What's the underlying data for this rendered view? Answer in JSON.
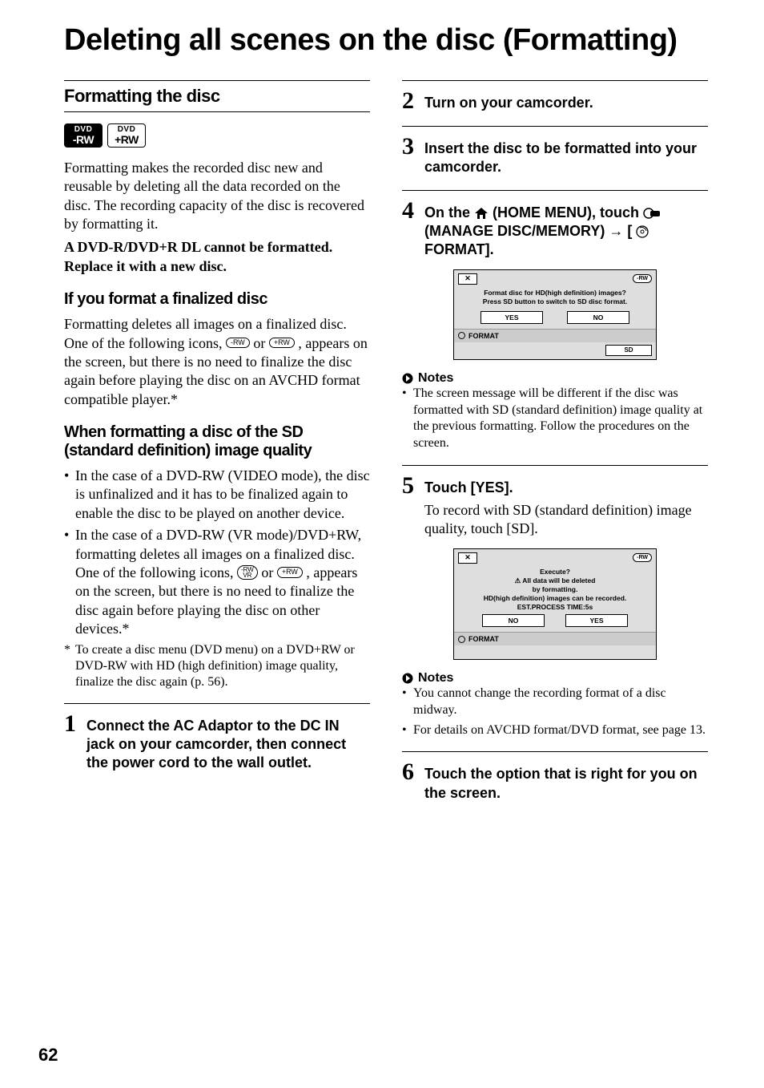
{
  "title": "Deleting all scenes on the disc (Formatting)",
  "section": {
    "heading": "Formatting the disc",
    "badges": [
      {
        "line1": "DVD",
        "line2": "-RW",
        "style": "solid"
      },
      {
        "line1": "DVD",
        "line2": "+RW",
        "style": "outlined"
      }
    ],
    "intro": "Formatting makes the recorded disc new and reusable by deleting all the data recorded on the disc. The recording capacity of the disc is recovered by formatting it.",
    "intro_bold": "A DVD-R/DVD+R DL cannot be formatted. Replace it with a new disc.",
    "sub1_heading": "If you format a finalized disc",
    "sub1_text_a": "Formatting deletes all images on a finalized disc. One of the following icons, ",
    "sub1_text_b": " or ",
    "sub1_text_c": " , appears on the screen, but there is no need to finalize the disc again before playing the disc on an AVCHD format compatible player.*",
    "sub2_heading": "When formatting a disc of the SD (standard definition) image quality",
    "sub2_bullets": [
      "In the case of a DVD-RW (VIDEO mode), the disc is unfinalized and it has to be finalized again to enable the disc to be played on another device.",
      "__SPECIAL__"
    ],
    "sub2_bullet2_a": "In the case of a DVD-RW (VR mode)/DVD+RW, formatting deletes all images on a finalized disc. One of the following icons, ",
    "sub2_bullet2_b": " or ",
    "sub2_bullet2_c": " , appears on the screen, but there is no need to finalize the disc again before playing the disc on other devices.*",
    "footnote": "To create a disc menu (DVD menu) on a DVD+RW or DVD-RW with HD (high definition) image quality, finalize the disc again (p. 56)."
  },
  "inline_icons": {
    "minus_rw": "-RW",
    "plus_rw": "+RW",
    "minus_rw_vr_top": "-RW",
    "minus_rw_vr_bot": "VR"
  },
  "steps": {
    "s1": {
      "num": "1",
      "text": "Connect the AC Adaptor to the DC IN jack on your camcorder, then connect the power cord to the wall outlet."
    },
    "s2": {
      "num": "2",
      "text": "Turn on your camcorder."
    },
    "s3": {
      "num": "3",
      "text": "Insert the disc to be formatted into your camcorder."
    },
    "s4": {
      "num": "4",
      "text_a": "On the ",
      "text_b": " (HOME MENU), touch ",
      "text_c": " (MANAGE DISC/MEMORY) → [",
      "text_d": "FORMAT]."
    },
    "s5": {
      "num": "5",
      "text": "Touch [YES].",
      "sub": "To record with SD (standard definition) image quality, touch [SD]."
    },
    "s6": {
      "num": "6",
      "text": "Touch the option that is right for you on the screen."
    }
  },
  "screenshot1": {
    "close": "✕",
    "rw": "-RW",
    "msg1": "Format disc for HD(high definition) images?",
    "msg2": "Press SD button to switch to SD disc format.",
    "yes": "YES",
    "no": "NO",
    "footer": "FORMAT",
    "sd": "SD"
  },
  "screenshot2": {
    "close": "✕",
    "rw": "-RW",
    "line1": "Execute?",
    "line2": "All data will be deleted",
    "line3": "by formatting.",
    "line4": "HD(high definition) images can be recorded.",
    "line5": "EST.PROCESS TIME:5s",
    "no": "NO",
    "yes": "YES",
    "footer": "FORMAT"
  },
  "notes_label": "Notes",
  "notes1": [
    "The screen message will be different if the disc was formatted with SD (standard definition) image quality at the previous formatting. Follow the procedures on the screen."
  ],
  "notes2": [
    "You cannot change the recording format of a disc midway.",
    "For details on AVCHD format/DVD format, see page 13."
  ],
  "page_number": "62"
}
